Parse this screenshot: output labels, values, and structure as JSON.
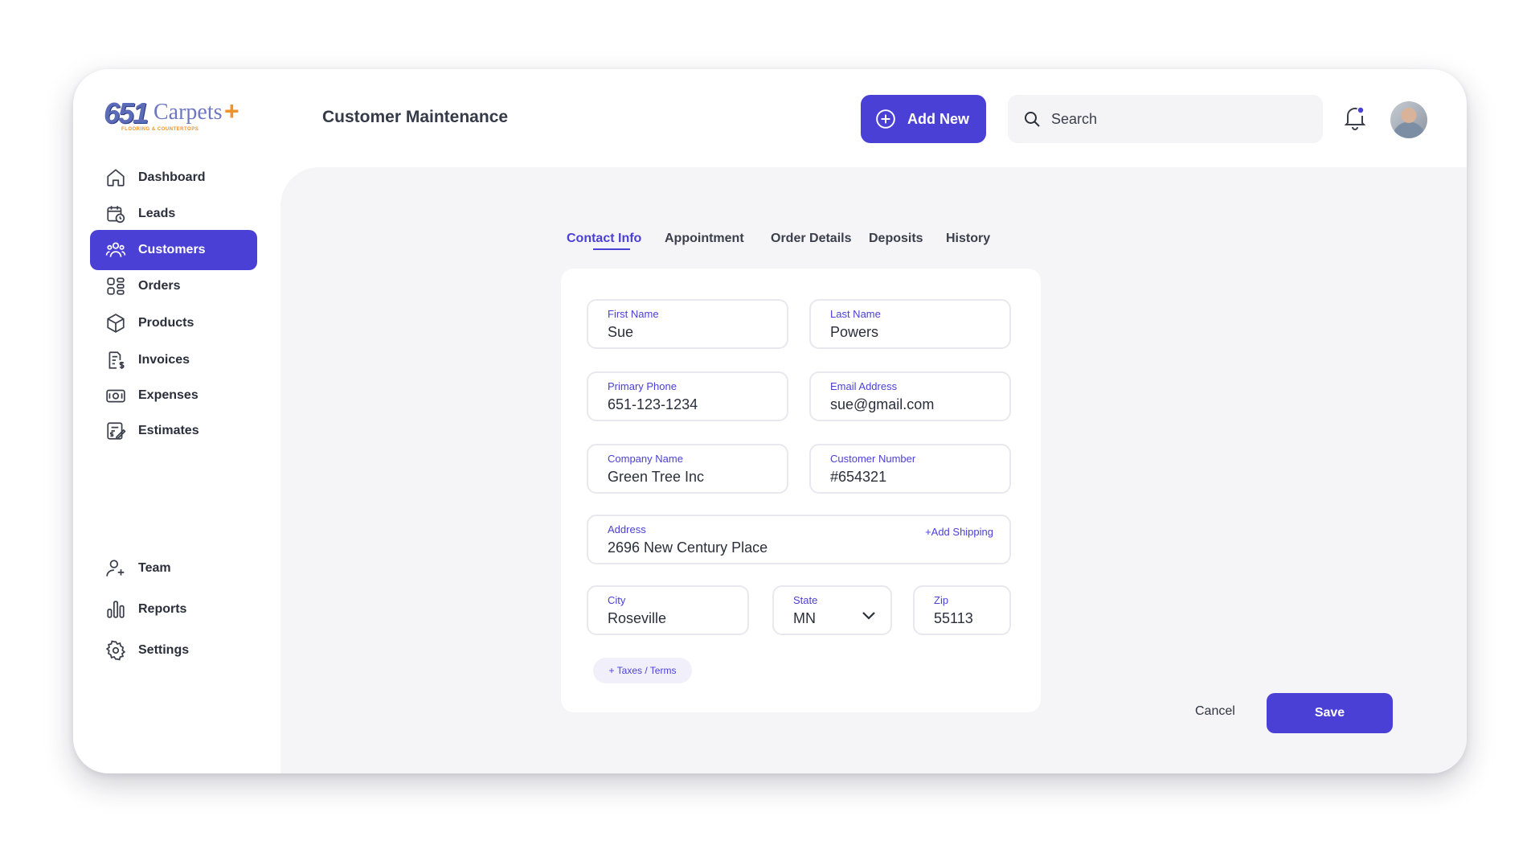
{
  "brand": {
    "logo_number": "651",
    "logo_name": "Carpets",
    "logo_plus": "+",
    "logo_tagline": "FLOORING & COUNTERTOPS",
    "accent_color": "#4b40d6",
    "logo_orange": "#f0932b"
  },
  "header": {
    "title": "Customer Maintenance",
    "add_new_label": "Add New",
    "search_placeholder": "Search",
    "notification_badge_color": "#4b40d6"
  },
  "sidebar": {
    "items": [
      {
        "label": "Dashboard",
        "icon": "home-icon"
      },
      {
        "label": "Leads",
        "icon": "calendar-clock-icon"
      },
      {
        "label": "Customers",
        "icon": "users-icon",
        "active": true
      },
      {
        "label": "Orders",
        "icon": "grid-icon"
      },
      {
        "label": "Products",
        "icon": "box-icon"
      },
      {
        "label": "Invoices",
        "icon": "invoice-icon"
      },
      {
        "label": "Expenses",
        "icon": "money-icon"
      },
      {
        "label": "Estimates",
        "icon": "estimate-icon"
      }
    ],
    "bottom_items": [
      {
        "label": "Team",
        "icon": "user-plus-icon"
      },
      {
        "label": "Reports",
        "icon": "bar-chart-icon"
      },
      {
        "label": "Settings",
        "icon": "gear-icon"
      }
    ]
  },
  "tabs": [
    {
      "label": "Contact Info",
      "active": true
    },
    {
      "label": "Appointment"
    },
    {
      "label": "Order Details"
    },
    {
      "label": "Deposits"
    },
    {
      "label": "History"
    }
  ],
  "form": {
    "first_name": {
      "label": "First Name",
      "value": "Sue"
    },
    "last_name": {
      "label": "Last Name",
      "value": "Powers"
    },
    "primary_phone": {
      "label": "Primary Phone",
      "value": "651-123-1234"
    },
    "email": {
      "label": "Email Address",
      "value": "sue@gmail.com"
    },
    "company": {
      "label": "Company Name",
      "value": "Green Tree Inc"
    },
    "customer_number": {
      "label": "Customer Number",
      "value": "#654321"
    },
    "address": {
      "label": "Address",
      "value": "2696 New Century Place",
      "add_shipping": "+Add Shipping"
    },
    "city": {
      "label": "City",
      "value": "Roseville"
    },
    "state": {
      "label": "State",
      "value": "MN"
    },
    "zip": {
      "label": "Zip",
      "value": "55113"
    },
    "taxes_terms": "+ Taxes / Terms"
  },
  "actions": {
    "cancel": "Cancel",
    "save": "Save"
  }
}
